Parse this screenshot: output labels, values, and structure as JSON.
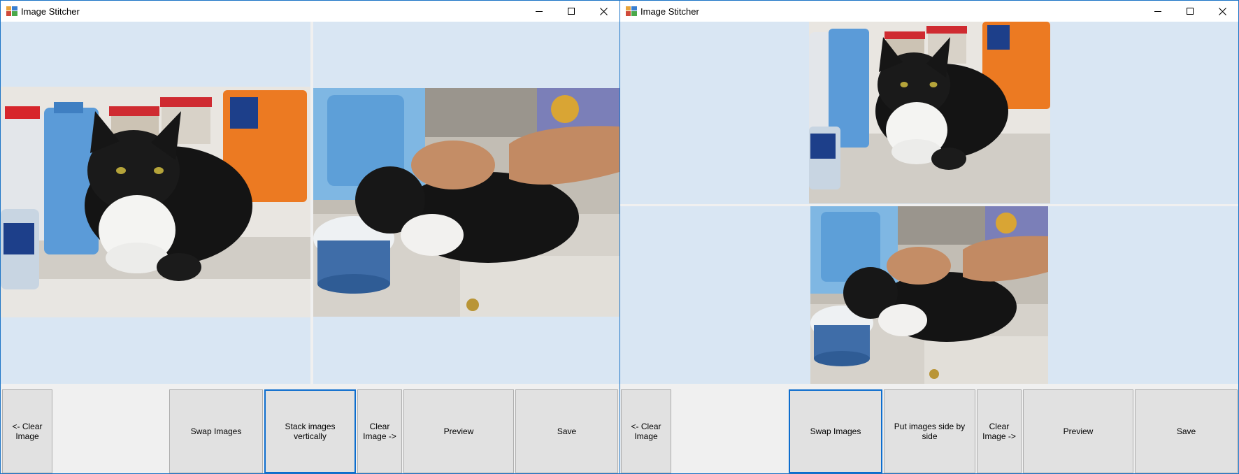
{
  "windows": [
    {
      "title": "Image Stitcher",
      "layout": "side-by-side",
      "buttons": {
        "clear_left": "<- Clear\nImage",
        "swap": "Swap Images",
        "mode": "Stack images vertically",
        "clear_right": "Clear\nImage ->",
        "preview": "Preview",
        "save": "Save"
      },
      "focused_button": "mode"
    },
    {
      "title": "Image Stitcher",
      "layout": "stacked",
      "buttons": {
        "clear_left": "<- Clear\nImage",
        "swap": "Swap Images",
        "mode": "Put images side by side",
        "clear_right": "Clear\nImage ->",
        "preview": "Preview",
        "save": "Save"
      },
      "focused_button": "swap"
    }
  ],
  "icons": {
    "app": "image-stitcher-app-icon",
    "minimize": "minimize-icon",
    "maximize": "maximize-icon",
    "close": "close-icon"
  },
  "colors": {
    "border": "#1a73c6",
    "canvas": "#d9e6f3",
    "button": "#e1e1e1",
    "focus": "#0c6dce"
  }
}
